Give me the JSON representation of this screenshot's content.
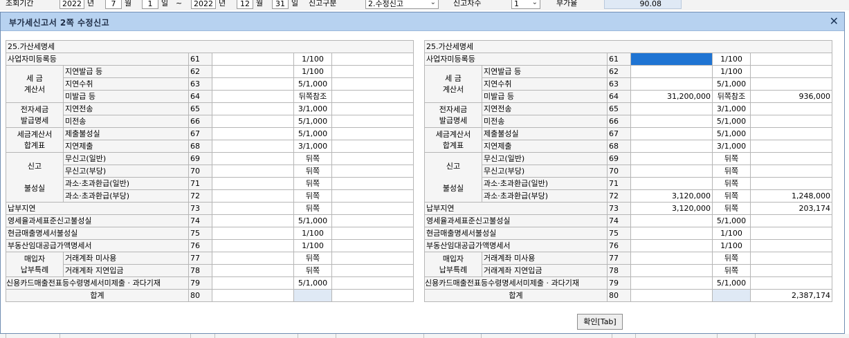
{
  "topbar": {
    "period_label": "조회기간",
    "from_year": "2022",
    "year_unit": "년",
    "from_month": "7",
    "month_unit": "월",
    "from_day": "1",
    "day_unit": "일",
    "tilde": "~",
    "to_year": "2022",
    "to_month": "12",
    "to_day": "31",
    "report_type_label": "신고구분",
    "report_type_value": "2.수정신고",
    "report_seq_label": "신고차수",
    "report_seq_value": "1",
    "extra_label": "부가율",
    "extra_value": "90.08"
  },
  "dialog": {
    "title": "부가세신고서 2쪽 수정신고",
    "close_icon": "close-icon",
    "ok_label": "확인[Tab]"
  },
  "left": {
    "section_title": "25.가산세명세",
    "total_label": "합계",
    "rows": [
      {
        "code": "61",
        "rate": "1/100",
        "amount": "",
        "tax": ""
      },
      {
        "code": "62",
        "rate": "1/100",
        "amount": "",
        "tax": ""
      },
      {
        "code": "63",
        "rate": "5/1,000",
        "amount": "",
        "tax": ""
      },
      {
        "code": "64",
        "rate": "뒤쪽참조",
        "amount": "",
        "tax": ""
      },
      {
        "code": "65",
        "rate": "3/1,000",
        "amount": "",
        "tax": ""
      },
      {
        "code": "66",
        "rate": "5/1,000",
        "amount": "",
        "tax": ""
      },
      {
        "code": "67",
        "rate": "5/1,000",
        "amount": "",
        "tax": ""
      },
      {
        "code": "68",
        "rate": "3/1,000",
        "amount": "",
        "tax": ""
      },
      {
        "code": "69",
        "rate": "뒤쪽",
        "amount": "",
        "tax": ""
      },
      {
        "code": "70",
        "rate": "뒤쪽",
        "amount": "",
        "tax": ""
      },
      {
        "code": "71",
        "rate": "뒤쪽",
        "amount": "",
        "tax": ""
      },
      {
        "code": "72",
        "rate": "뒤쪽",
        "amount": "",
        "tax": ""
      },
      {
        "code": "73",
        "rate": "뒤쪽",
        "amount": "",
        "tax": ""
      },
      {
        "code": "74",
        "rate": "5/1,000",
        "amount": "",
        "tax": ""
      },
      {
        "code": "75",
        "rate": "1/100",
        "amount": "",
        "tax": ""
      },
      {
        "code": "76",
        "rate": "1/100",
        "amount": "",
        "tax": ""
      },
      {
        "code": "77",
        "rate": "뒤쪽",
        "amount": "",
        "tax": ""
      },
      {
        "code": "78",
        "rate": "뒤쪽",
        "amount": "",
        "tax": ""
      },
      {
        "code": "79",
        "rate": "5/1,000",
        "amount": "",
        "tax": ""
      },
      {
        "code": "80",
        "rate": "",
        "amount": "",
        "tax": ""
      }
    ]
  },
  "right": {
    "section_title": "25.가산세명세",
    "total_label": "합계",
    "rows": [
      {
        "code": "61",
        "rate": "1/100",
        "amount": "",
        "tax": ""
      },
      {
        "code": "62",
        "rate": "1/100",
        "amount": "",
        "tax": ""
      },
      {
        "code": "63",
        "rate": "5/1,000",
        "amount": "",
        "tax": ""
      },
      {
        "code": "64",
        "rate": "뒤쪽참조",
        "amount": "31,200,000",
        "tax": "936,000"
      },
      {
        "code": "65",
        "rate": "3/1,000",
        "amount": "",
        "tax": ""
      },
      {
        "code": "66",
        "rate": "5/1,000",
        "amount": "",
        "tax": ""
      },
      {
        "code": "67",
        "rate": "5/1,000",
        "amount": "",
        "tax": ""
      },
      {
        "code": "68",
        "rate": "3/1,000",
        "amount": "",
        "tax": ""
      },
      {
        "code": "69",
        "rate": "뒤쪽",
        "amount": "",
        "tax": ""
      },
      {
        "code": "70",
        "rate": "뒤쪽",
        "amount": "",
        "tax": ""
      },
      {
        "code": "71",
        "rate": "뒤쪽",
        "amount": "",
        "tax": ""
      },
      {
        "code": "72",
        "rate": "뒤쪽",
        "amount": "3,120,000",
        "tax": "1,248,000"
      },
      {
        "code": "73",
        "rate": "뒤쪽",
        "amount": "3,120,000",
        "tax": "203,174"
      },
      {
        "code": "74",
        "rate": "5/1,000",
        "amount": "",
        "tax": ""
      },
      {
        "code": "75",
        "rate": "1/100",
        "amount": "",
        "tax": ""
      },
      {
        "code": "76",
        "rate": "1/100",
        "amount": "",
        "tax": ""
      },
      {
        "code": "77",
        "rate": "뒤쪽",
        "amount": "",
        "tax": ""
      },
      {
        "code": "78",
        "rate": "뒤쪽",
        "amount": "",
        "tax": ""
      },
      {
        "code": "79",
        "rate": "5/1,000",
        "amount": "",
        "tax": ""
      },
      {
        "code": "80",
        "rate": "",
        "amount": "",
        "tax": "2,387,174"
      }
    ]
  },
  "labels": {
    "r61": "사업자미등록등",
    "g_invoice_a": "세  금",
    "g_invoice_b": "계산서",
    "r62": "지연발급 등",
    "r63": "지연수취",
    "r64": "미발급 등",
    "g_einvoice_a": "전자세금",
    "g_einvoice_b": "발급명세",
    "r65": "지연전송",
    "r66": "미전송",
    "g_summary_a": "세금계산서",
    "g_summary_b": "합계표",
    "r67": "제출불성실",
    "r68": "지연제출",
    "g_report_a": "신고",
    "g_report_b": "불성실",
    "r69": "무신고(일반)",
    "r70": "무신고(부당)",
    "r71": "과소·초과환급(일반)",
    "r72": "과소·초과환급(부당)",
    "r73": "납부지연",
    "r74": "영세율과세표준신고불성실",
    "r75": "현금매출명세서불성실",
    "r76": "부동산임대공급가액명세서",
    "g_buyer_a": "매입자",
    "g_buyer_b": "납부특례",
    "r77": "거래계좌 미사용",
    "r78": "거래계좌 지연입금",
    "r79": "신용카드매출전표등수령명세서미제출 · 과다기재"
  }
}
